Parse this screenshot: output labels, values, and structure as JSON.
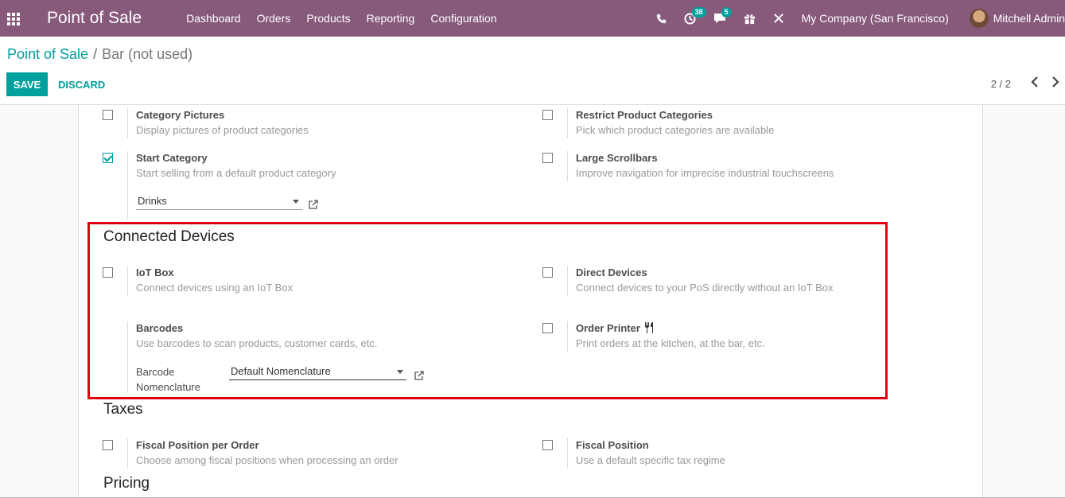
{
  "navbar": {
    "brand": "Point of Sale",
    "menu": [
      "Dashboard",
      "Orders",
      "Products",
      "Reporting",
      "Configuration"
    ],
    "activity_count": "38",
    "message_count": "5",
    "company": "My Company (San Francisco)",
    "user": "Mitchell Admin"
  },
  "breadcrumb": {
    "parent": "Point of Sale",
    "separator": "/",
    "current": "Bar (not used)"
  },
  "buttons": {
    "save": "SAVE",
    "discard": "DISCARD"
  },
  "pager": {
    "text": "2 / 2"
  },
  "settings": {
    "category_pictures": {
      "title": "Category Pictures",
      "desc": "Display pictures of product categories",
      "checked": false
    },
    "restrict_categories": {
      "title": "Restrict Product Categories",
      "desc": "Pick which product categories are available",
      "checked": false
    },
    "start_category": {
      "title": "Start Category",
      "desc": "Start selling from a default product category",
      "checked": true,
      "value": "Drinks"
    },
    "large_scrollbars": {
      "title": "Large Scrollbars",
      "desc": "Improve navigation for imprecise industrial touchscreens",
      "checked": false
    },
    "iot_box": {
      "title": "IoT Box",
      "desc": "Connect devices using an IoT Box",
      "checked": false
    },
    "direct_devices": {
      "title": "Direct Devices",
      "desc": "Connect devices to your PoS directly without an IoT Box",
      "checked": false
    },
    "barcodes": {
      "title": "Barcodes",
      "desc": "Use barcodes to scan products, customer cards, etc.",
      "nomenclature_label_1": "Barcode",
      "nomenclature_label_2": "Nomenclature",
      "nomenclature_value": "Default Nomenclature"
    },
    "order_printer": {
      "title": "Order Printer",
      "desc": "Print orders at the kitchen, at the bar, etc.",
      "checked": false
    },
    "fiscal_position_per_order": {
      "title": "Fiscal Position per Order",
      "desc": "Choose among fiscal positions when processing an order",
      "checked": false
    },
    "fiscal_position": {
      "title": "Fiscal Position",
      "desc": "Use a default specific tax regime",
      "checked": false
    }
  },
  "sections": {
    "connected_devices": "Connected Devices",
    "taxes": "Taxes",
    "pricing": "Pricing"
  },
  "colors": {
    "navbar": "#875a7b",
    "accent": "#00a09d",
    "highlight": "#e0000e"
  }
}
